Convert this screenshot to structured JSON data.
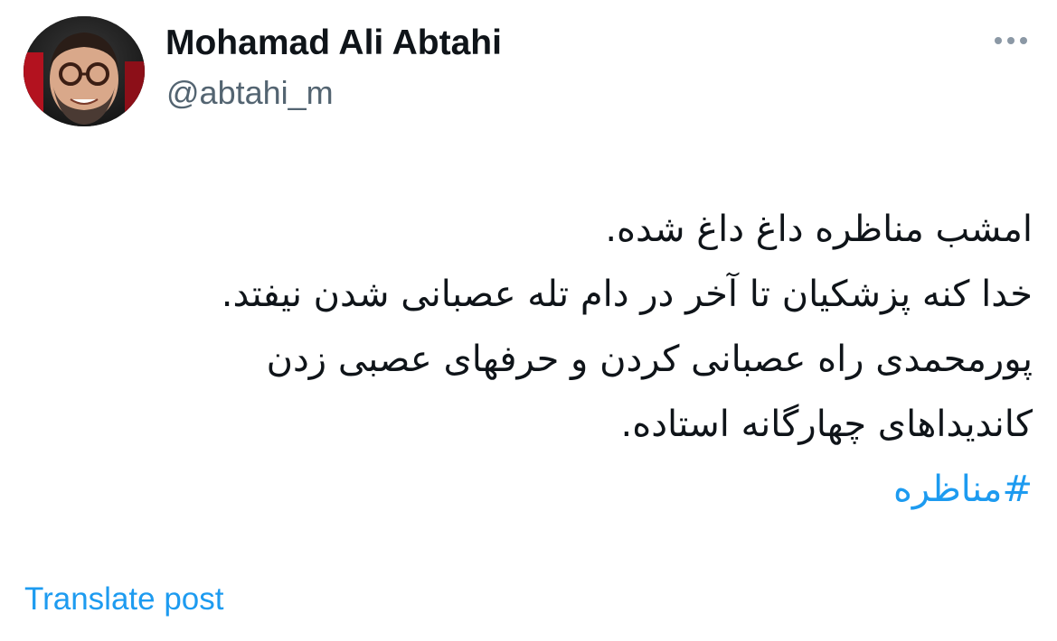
{
  "author": {
    "name": "Mohamad Ali Abtahi",
    "handle": "@abtahi_m",
    "avatar_icon": "profile-photo"
  },
  "more_icon": "more-horizontal-icon",
  "post": {
    "lines": [
      "امشب مناظره داغ داغ شده.",
      "خدا کنه پزشکیان تا آخر در دام تله عصبانی شدن نیفتد.",
      "پورمحمدی راه عصبانی کردن و حرفهای عصبی زدن",
      "کاندیداهای چهارگانه استاده."
    ],
    "hashtag": "#مناظره"
  },
  "actions": {
    "translate_label": "Translate post"
  },
  "colors": {
    "text": "#0f1419",
    "secondary_text": "#536471",
    "link": "#1d9bf0",
    "background": "#ffffff"
  }
}
